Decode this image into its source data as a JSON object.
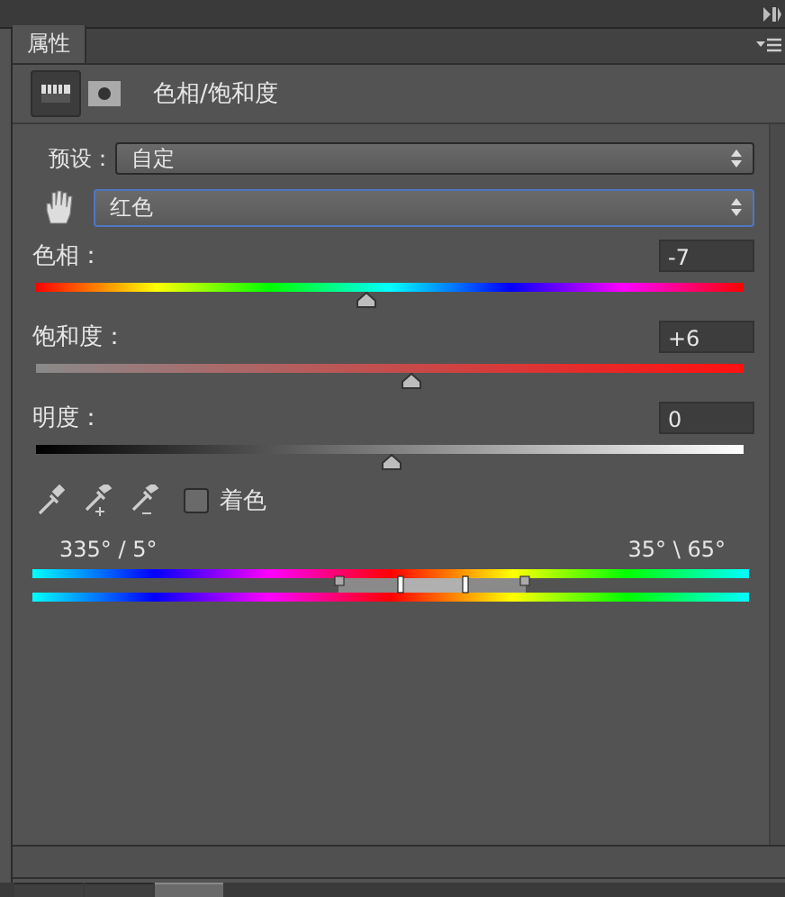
{
  "panel_tab": {
    "label": "属性",
    "selected": true
  },
  "header": {
    "title": "色相/饱和度"
  },
  "preset": {
    "label": "预设：",
    "value": "自定"
  },
  "channel": {
    "value": "红色"
  },
  "sliders": [
    {
      "kind": "hue",
      "label": "色相：",
      "value": "-7",
      "level": 0.465
    },
    {
      "kind": "saturation",
      "label": "饱和度：",
      "value": "+6",
      "level": 0.528
    },
    {
      "kind": "lightness",
      "label": "明度：",
      "value": "0",
      "level": 0.5
    }
  ],
  "colorize": {
    "label": "着色",
    "checked": false
  },
  "range": {
    "left": "335° / 5°",
    "right": "35° \\ 65°"
  },
  "bottom_tabs": [
    {
      "selected": false
    },
    {
      "selected": false
    },
    {
      "selected": true
    }
  ]
}
